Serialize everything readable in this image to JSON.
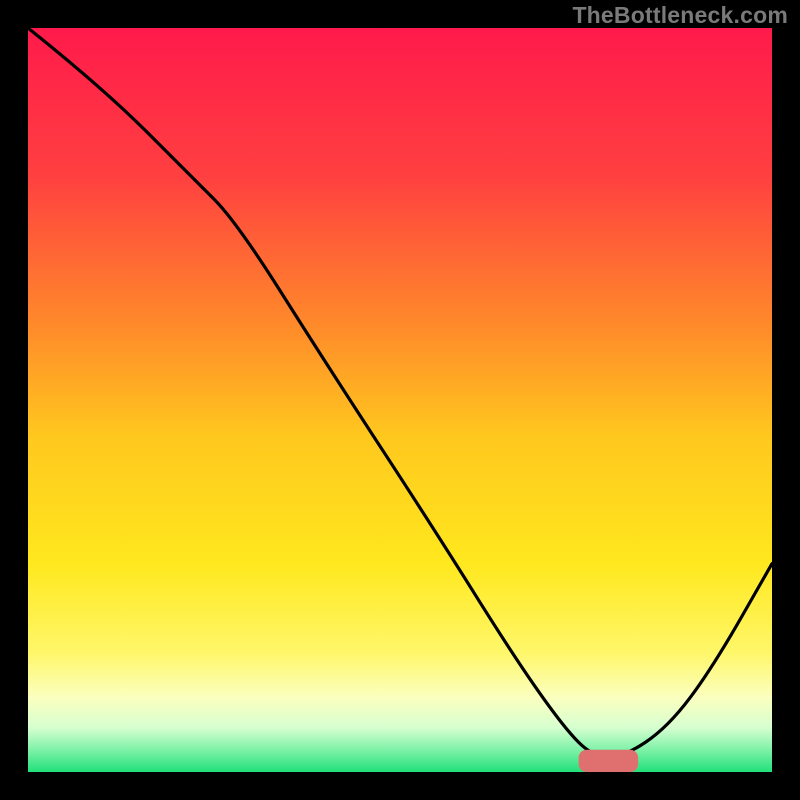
{
  "watermark": "TheBottleneck.com",
  "chart_data": {
    "type": "line",
    "title": "",
    "xlabel": "",
    "ylabel": "",
    "legend": false,
    "grid": false,
    "xlim": [
      0,
      100
    ],
    "ylim": [
      0,
      100
    ],
    "background_gradient": {
      "stops": [
        {
          "pos": 0.0,
          "color": "#ff1a4b"
        },
        {
          "pos": 0.2,
          "color": "#ff4040"
        },
        {
          "pos": 0.4,
          "color": "#ff8a2a"
        },
        {
          "pos": 0.55,
          "color": "#ffc81e"
        },
        {
          "pos": 0.72,
          "color": "#ffe81e"
        },
        {
          "pos": 0.84,
          "color": "#fff76a"
        },
        {
          "pos": 0.9,
          "color": "#fbffbf"
        },
        {
          "pos": 0.94,
          "color": "#d7ffd0"
        },
        {
          "pos": 0.97,
          "color": "#7ff2a8"
        },
        {
          "pos": 1.0,
          "color": "#22e07a"
        }
      ]
    },
    "series": [
      {
        "name": "bottleneck-curve",
        "color": "#000000",
        "x": [
          0,
          10,
          22,
          28,
          40,
          55,
          65,
          72,
          76,
          80,
          86,
          92,
          100
        ],
        "values": [
          100,
          92,
          80,
          74,
          55,
          32,
          16,
          6,
          2,
          2,
          6,
          14,
          28
        ]
      }
    ],
    "marker": {
      "name": "optimal-marker",
      "color": "#e07070",
      "x_start": 74,
      "x_end": 82,
      "y": 1.5,
      "height": 3
    }
  }
}
